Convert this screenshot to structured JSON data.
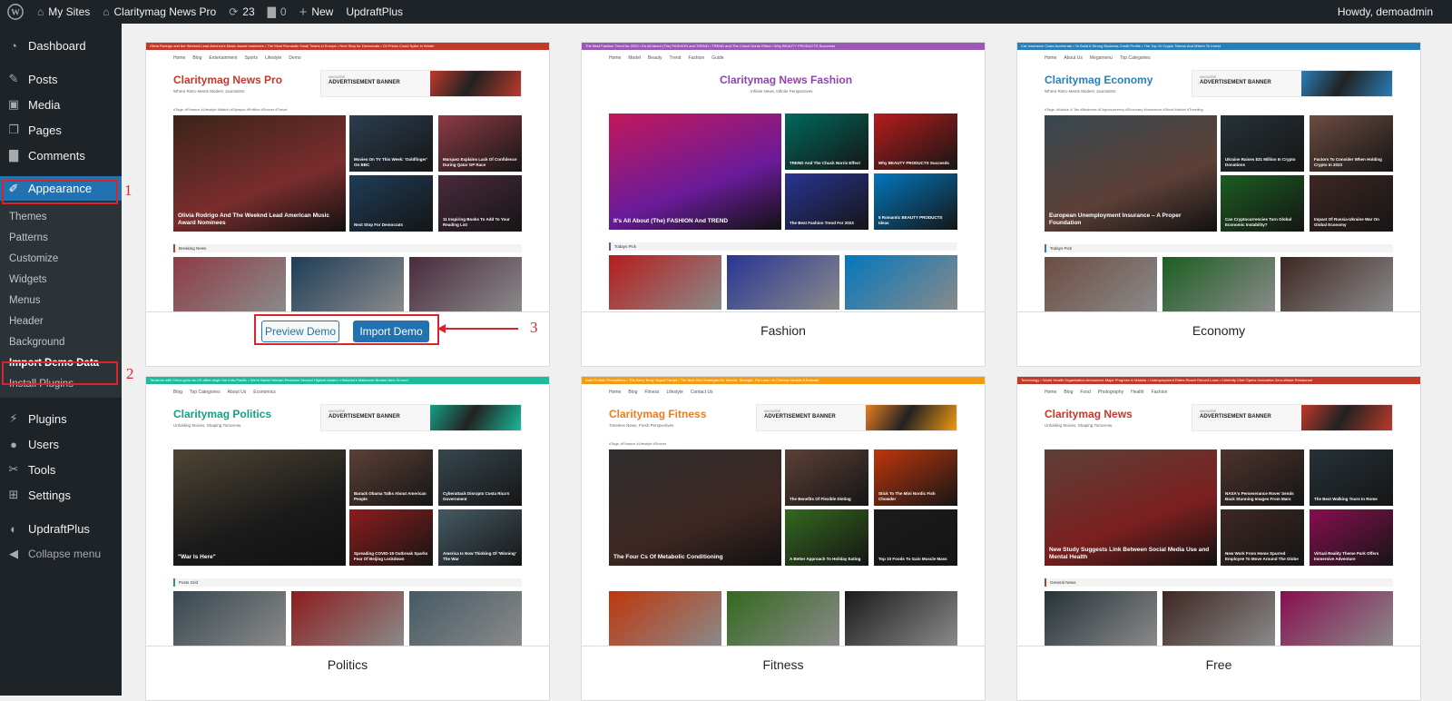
{
  "adminbar": {
    "my_sites": "My Sites",
    "site_name": "Claritymag News Pro",
    "updates_count": "23",
    "comments_count": "0",
    "new_label": "New",
    "updraft": "UpdraftPlus",
    "howdy": "Howdy, demoadmin"
  },
  "sidebar": {
    "dashboard": "Dashboard",
    "posts": "Posts",
    "media": "Media",
    "pages": "Pages",
    "comments": "Comments",
    "appearance": "Appearance",
    "submenu": [
      "Themes",
      "Patterns",
      "Customize",
      "Widgets",
      "Menus",
      "Header",
      "Background",
      "Import Demo Data",
      "Install Plugins"
    ],
    "plugins": "Plugins",
    "users": "Users",
    "tools": "Tools",
    "settings": "Settings",
    "updraftplus": "UpdraftPlus",
    "collapse": "Collapse menu"
  },
  "steps": {
    "one": "1",
    "two": "2",
    "three": "3"
  },
  "buttons": {
    "preview": "Preview Demo",
    "import": "Import Demo"
  },
  "demos": [
    {
      "label": "",
      "title": "Claritymag News Pro",
      "tagline": "Where Retro Meets Modern Journalism",
      "title_color": "#c0392b",
      "ticker_color": "#c0392b",
      "ticker": "Olivia Rodrigo and the Weeknd Lead America's Music Award nominees   •   The Most Romantic Small Towns in Europe   •   Next Stop for Democrats   •   Oil Prices Could Spike in Winter",
      "nav": [
        "Home",
        "Blog",
        "Entertainment",
        "Sports",
        "Lifestyle",
        "Demo"
      ],
      "tags": "#Tags:  #Finance  #Lifestyle  #Match  #Olympic  #Politics  #Soccer  #Travel",
      "main_caption": "Olivia Rodrigo And The Weeknd Lead American Music Award Nominees",
      "side_captions": [
        "Movies On TV This Week: 'Goldfinger' On BBC",
        "Marquez Explains Lack Of Confidence During Qatar GP Race",
        "Next Stop For Democrats",
        "11 Inspiring Books To Add To Your Reading List"
      ],
      "section": "Breaking News"
    },
    {
      "label": "Fashion",
      "title": "Claritymag News Fashion",
      "tagline": "Infinite News, Infinite Perspectives",
      "title_color": "#8e44ad",
      "ticker_color": "#9b59b6",
      "ticker": "The Best Fashion Trend for 2023   •   It's All About (The) FASHION and TREND   •   TREND and The Chuck Norris Effect   •   Why BEAUTY PRODUCTS Succeeds",
      "nav": [
        "Home",
        "Model",
        "Beauty",
        "Trend",
        "Fashion",
        "Guide"
      ],
      "tags": "",
      "main_caption": "It's All About (The) FASHION And TREND",
      "side_captions": [
        "TREND And The Chuck Norris Effect",
        "Why BEAUTY PRODUCTS Succeeds",
        "The Best Fashion Trend For 2023",
        "5 Romantic BEAUTY PRODUCTS Ideas"
      ],
      "section": "Todays Pick"
    },
    {
      "label": "Economy",
      "title": "Claritymag Economy",
      "tagline": "Where Retro Meets Modern Journalism",
      "title_color": "#2980b9",
      "ticker_color": "#2980b9",
      "ticker": "Car Insurance Costs Accelerate   •   To Build A Strong Business Credit Profile   •   The Top 10 Crypto Tokens And Where To Invest",
      "nav": [
        "Home",
        "About Us",
        "Megamenu",
        "Top Categories"
      ],
      "tags": "#Tags:  #Advice & Tax  #Business  #Cryptocurrency  #Economy  #Insurance  #Stock Market  #Trending",
      "main_caption": "European Unemployment Insurance – A Proper Foundation",
      "side_captions": [
        "Ukraine Raises $31 Million In Crypto Donations",
        "Factors To Consider When Holding Crypto In 2023",
        "Can Cryptocurrencies Turn Global Economic Instability?",
        "Impact Of Russia-Ukraine War On Global Economy"
      ],
      "section": "Todays Pick"
    },
    {
      "label": "Politics",
      "title": "Claritymag Politics",
      "tagline": "Unfolding Stories, Shaping Tomorrow",
      "title_color": "#16a085",
      "ticker_color": "#1abc9c",
      "ticker": "Tensions with China grow as US allies begin the Indo-Pacific   •   We're Nadal Veteran Receives Second Highest Award   •   Historian's Makeover Breaks New Ground",
      "nav": [
        "Blog",
        "Top Categories",
        "About Us",
        "Economics"
      ],
      "tags": "",
      "main_caption": "\"War Is Here\"",
      "side_captions": [
        "Barack Obama Talks About American People",
        "Cyberattack Disrupts Costa Rica's Government",
        "Spreading COVID-19 Outbreak Sparks Fear Of Beijing Lockdown",
        "America Is Now Thinking Of 'Winning' The War"
      ],
      "section": "Posts Grid"
    },
    {
      "label": "Fitness",
      "title": "Claritymag Fitness",
      "tagline": "Timeless News, Fresh Perspectives",
      "title_color": "#e67e22",
      "ticker_color": "#f39c12",
      "ticker": "Dark Protein Precautions   •   The Berry Body Yogurt Parfait   •   The Best Diet Strategies for Muscle, Strength, Fat Loss   •   Is Chinese Muscle A Bulwark",
      "nav": [
        "Home",
        "Blog",
        "Fitness",
        "Lifestyle",
        "Contact Us"
      ],
      "tags": "#Tags:  #Finance  #Lifestyle  #Soccer",
      "main_caption": "The Four Cs Of Metabolic Conditioning",
      "side_captions": [
        "The Benefits Of Flexible Dieting",
        "Stick To The Mini Nordic Fish Chowder",
        "A Better Approach To Holiday Eating",
        "Top 10 Foods To Gain Muscle Mass"
      ],
      "section": ""
    },
    {
      "label": "Free",
      "title": "Claritymag News",
      "tagline": "Unfolding Stories, Shaping Tomorrow",
      "title_color": "#c0392b",
      "ticker_color": "#c0392b",
      "ticker": "Technology   •   World Health Organisation Announces Major Progress in Malaria   •   Unemployment Rates Reach Record Lows   •   Celebrity Chef Opens Innovative Zero-Waste Restaurant",
      "nav": [
        "Home",
        "Blog",
        "Food",
        "Photography",
        "Health",
        "Fashion"
      ],
      "tags": "",
      "main_caption": "New Study Suggests Link Between Social Media Use and Mental Health",
      "side_captions": [
        "NASA's Perseverance Rover Sends Back Stunning Images From Mars",
        "The Best Walking Tours In Rome",
        "New Work From Home Spurred Employee To Move Around The Globe",
        "Virtual Reality Theme Park Offers Immersive Adventure"
      ],
      "section": "General News"
    }
  ]
}
